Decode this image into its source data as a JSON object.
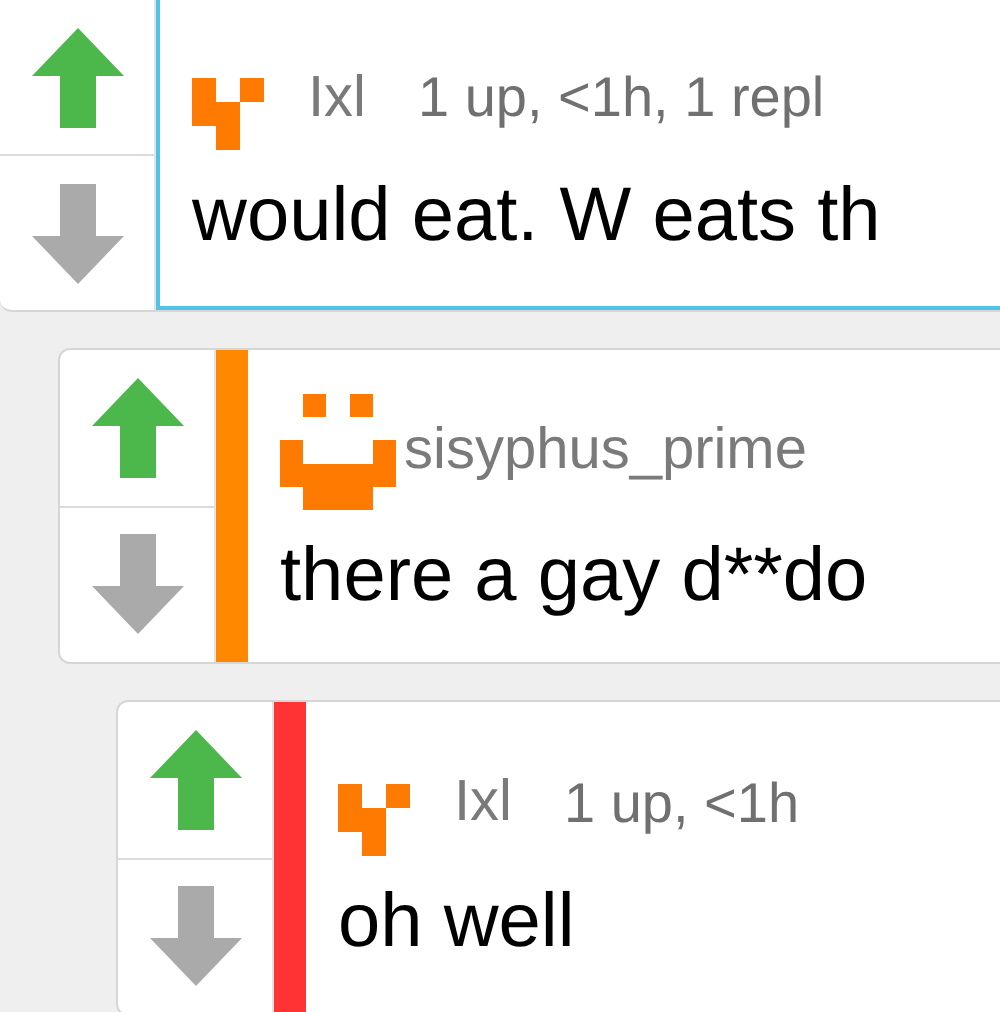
{
  "comments": [
    {
      "username": "Ixl",
      "meta": "1 up, <1h, 1 repl",
      "body": "would eat. W eats th",
      "upvoted": true,
      "downvoted": false,
      "highlighted": true,
      "color": "#4fc3e8",
      "kind": "blocks",
      "children": [
        {
          "username": "sisyphus_prime",
          "body": "there a gay d**do",
          "upvoted": true,
          "downvoted": false,
          "highlighted": false,
          "color": "#ff8800",
          "kind": "face",
          "children": [
            {
              "username": "Ixl",
              "meta": "1 up, <1h",
              "body": "oh well",
              "upvoted": true,
              "downvoted": false,
              "highlighted": false,
              "color": "#ff3333",
              "kind": "blocks"
            }
          ]
        }
      ]
    }
  ]
}
